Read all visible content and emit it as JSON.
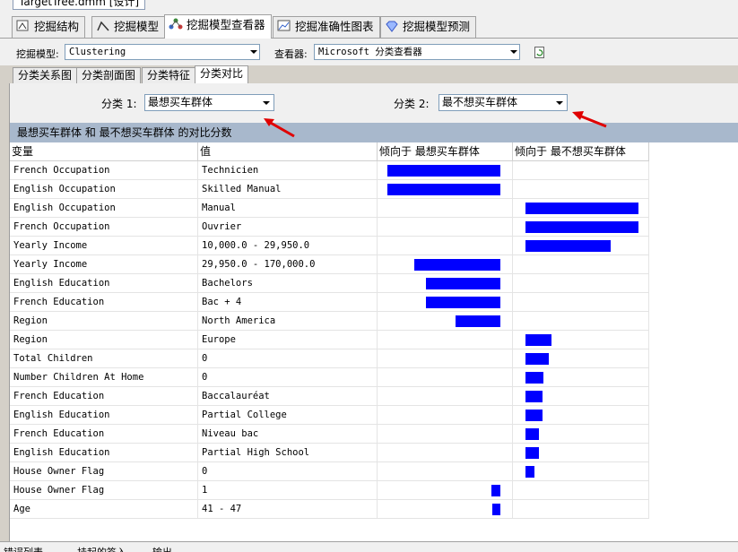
{
  "window": {
    "doc_tab": "TargetTree.dmm [设计]"
  },
  "main_tabs": [
    {
      "label": "挖掘结构",
      "icon": "mining-structure-icon"
    },
    {
      "label": "挖掘模型",
      "icon": "mining-model-icon"
    },
    {
      "label": "挖掘模型查看器",
      "icon": "model-viewer-icon"
    },
    {
      "label": "挖掘准确性图表",
      "icon": "accuracy-chart-icon"
    },
    {
      "label": "挖掘模型预测",
      "icon": "model-prediction-icon"
    }
  ],
  "toolbar": {
    "model_label": "挖掘模型:",
    "model_value": "Clustering",
    "viewer_label": "查看器:",
    "viewer_value": "Microsoft 分类查看器"
  },
  "sub_tabs": [
    "分类关系图",
    "分类剖面图",
    "分类特征",
    "分类对比"
  ],
  "selectors": {
    "cluster1_label": "分类 1:",
    "cluster1_value": "最想买车群体",
    "cluster2_label": "分类 2:",
    "cluster2_value": "最不想买车群体"
  },
  "banner": "最想买车群体 和 最不想买车群体 的对比分数",
  "columns": [
    "变量",
    "值",
    "倾向于 最想买车群体",
    "倾向于 最不想买车群体"
  ],
  "rows": [
    {
      "variable": "French Occupation",
      "value": "Technicien",
      "favors": 1,
      "score": 100
    },
    {
      "variable": "English Occupation",
      "value": "Skilled Manual",
      "favors": 1,
      "score": 100
    },
    {
      "variable": "English Occupation",
      "value": "Manual",
      "favors": 2,
      "score": 100
    },
    {
      "variable": "French Occupation",
      "value": "Ouvrier",
      "favors": 2,
      "score": 100
    },
    {
      "variable": "Yearly Income",
      "value": "10,000.0 - 29,950.0",
      "favors": 2,
      "score": 75
    },
    {
      "variable": "Yearly Income",
      "value": "29,950.0 - 170,000.0",
      "favors": 1,
      "score": 76
    },
    {
      "variable": "English Education",
      "value": "Bachelors",
      "favors": 1,
      "score": 66
    },
    {
      "variable": "French Education",
      "value": "Bac + 4",
      "favors": 1,
      "score": 66
    },
    {
      "variable": "Region",
      "value": "North America",
      "favors": 1,
      "score": 40
    },
    {
      "variable": "Region",
      "value": "Europe",
      "favors": 2,
      "score": 23
    },
    {
      "variable": "Total Children",
      "value": "0",
      "favors": 2,
      "score": 21
    },
    {
      "variable": "Number Children At Home",
      "value": "0",
      "favors": 2,
      "score": 16
    },
    {
      "variable": "French Education",
      "value": "Baccalauréat",
      "favors": 2,
      "score": 15
    },
    {
      "variable": "English Education",
      "value": "Partial College",
      "favors": 2,
      "score": 15
    },
    {
      "variable": "French Education",
      "value": "Niveau bac",
      "favors": 2,
      "score": 12
    },
    {
      "variable": "English Education",
      "value": "Partial High School",
      "favors": 2,
      "score": 12
    },
    {
      "variable": "House Owner Flag",
      "value": "0",
      "favors": 2,
      "score": 8
    },
    {
      "variable": "House Owner Flag",
      "value": "1",
      "favors": 1,
      "score": 8
    },
    {
      "variable": "Age",
      "value": "41 - 47",
      "favors": 1,
      "score": 7
    }
  ],
  "bottom_tabs": [
    "错误列表",
    "挂起的签入",
    "输出"
  ],
  "colors": {
    "bar": "#0000ff",
    "banner": "#a8b8cc",
    "arrow": "#e00000"
  }
}
